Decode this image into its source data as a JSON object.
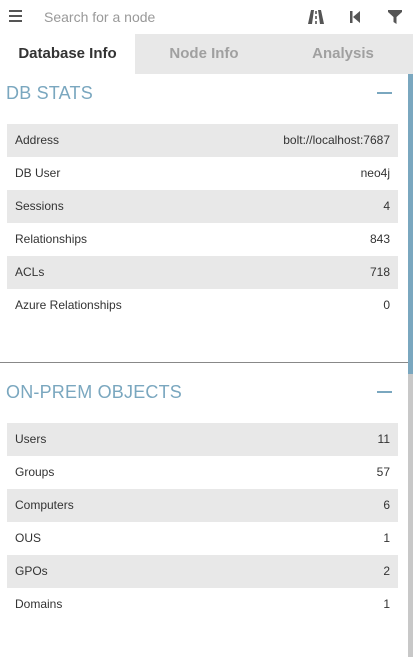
{
  "search": {
    "placeholder": "Search for a node"
  },
  "icons": {
    "menu": "hamburger-menu-icon",
    "pathfinding": "pathfinding-road-icon",
    "back": "back-step-icon",
    "filter": "filter-icon"
  },
  "colors": {
    "accent": "#7aa7bf",
    "tab_inactive_bg": "#e8e8e8",
    "row_shaded": "#e8e8e8"
  },
  "tabs": [
    {
      "label": "Database Info",
      "active": true
    },
    {
      "label": "Node Info",
      "active": false
    },
    {
      "label": "Analysis",
      "active": false
    }
  ],
  "db_stats": {
    "title": "DB STATS",
    "rows": [
      {
        "label": "Address",
        "value": "bolt://localhost:7687"
      },
      {
        "label": "DB User",
        "value": "neo4j"
      },
      {
        "label": "Sessions",
        "value": "4"
      },
      {
        "label": "Relationships",
        "value": "843"
      },
      {
        "label": "ACLs",
        "value": "718"
      },
      {
        "label": "Azure Relationships",
        "value": "0"
      }
    ]
  },
  "on_prem": {
    "title": "ON-PREM OBJECTS",
    "rows": [
      {
        "label": "Users",
        "value": "11"
      },
      {
        "label": "Groups",
        "value": "57"
      },
      {
        "label": "Computers",
        "value": "6"
      },
      {
        "label": "OUS",
        "value": "1"
      },
      {
        "label": "GPOs",
        "value": "2"
      },
      {
        "label": "Domains",
        "value": "1"
      }
    ]
  }
}
